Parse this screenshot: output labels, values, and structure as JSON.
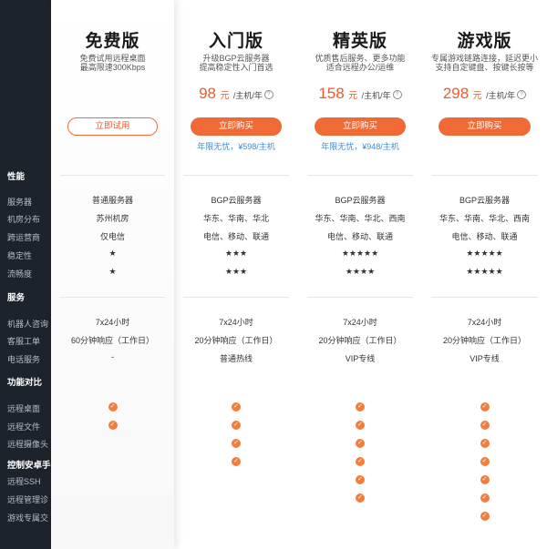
{
  "sidebar": {
    "groups": [
      {
        "title": "性能",
        "items": [
          "服务器",
          "机房分布",
          "跨运营商",
          "稳定性",
          "流畅度"
        ]
      },
      {
        "title": "服务",
        "items": [
          "机器人咨询",
          "客服工单",
          "电话服务"
        ]
      },
      {
        "title": "功能对比",
        "items": [
          "远程桌面",
          "远程文件",
          "远程摄像头"
        ]
      },
      {
        "title": "控制安卓手",
        "items": [
          "远程SSH",
          "远程管理诊",
          "游戏专属交"
        ]
      }
    ]
  },
  "plans": [
    {
      "name": "免费版",
      "desc": [
        "免费试用远程桌面",
        "最高限速300Kbps"
      ],
      "price": null,
      "button": "立即试用",
      "note": "",
      "perf": [
        "普通服务器",
        "苏州机房",
        "仅电信",
        "★",
        "★"
      ],
      "service": [
        "7x24小时",
        "60分钟响应（工作日）",
        "-"
      ],
      "features": [
        true,
        true,
        false,
        false,
        false,
        false,
        false
      ]
    },
    {
      "name": "入门版",
      "desc": [
        "升级BGP云服务器",
        "提高稳定性入门首选"
      ],
      "price": {
        "amount": "98",
        "currency": "元",
        "unit": "/主机/年"
      },
      "button": "立即购买",
      "note": "年限无忧，¥598/主机",
      "perf": [
        "BGP云服务器",
        "华东、华南、华北",
        "电信、移动、联通",
        "★★★",
        "★★★"
      ],
      "service": [
        "7x24小时",
        "20分钟响应（工作日）",
        "普通热线"
      ],
      "features": [
        true,
        true,
        true,
        true,
        false,
        false,
        false
      ]
    },
    {
      "name": "精英版",
      "desc": [
        "优质售后服务、更多功能",
        "适合远程办公/运维"
      ],
      "price": {
        "amount": "158",
        "currency": "元",
        "unit": "/主机/年"
      },
      "button": "立即购买",
      "note": "年限无忧，¥948/主机",
      "perf": [
        "BGP云服务器",
        "华东、华南、华北、西南",
        "电信、移动、联通",
        "★★★★★",
        "★★★★"
      ],
      "service": [
        "7x24小时",
        "20分钟响应（工作日）",
        "VIP专线"
      ],
      "features": [
        true,
        true,
        true,
        true,
        true,
        true,
        false
      ]
    },
    {
      "name": "游戏版",
      "desc": [
        "专属游戏链路连接，延迟更小",
        "支持自定键盘、按键长按等"
      ],
      "price": {
        "amount": "298",
        "currency": "元",
        "unit": "/主机/年"
      },
      "button": "立即购买",
      "note": "",
      "perf": [
        "BGP云服务器",
        "华东、华南、华北、西南",
        "电信、移动、联通",
        "★★★★★",
        "★★★★★"
      ],
      "service": [
        "7x24小时",
        "20分钟响应（工作日）",
        "VIP专线"
      ],
      "features": [
        true,
        true,
        true,
        true,
        true,
        true,
        true
      ]
    }
  ],
  "colors": {
    "accent": "#f06a35",
    "note": "#3a8be0",
    "sidebar": "#1d232b"
  },
  "icons": {
    "check": "check-circle-icon",
    "help": "help-circle-icon"
  }
}
